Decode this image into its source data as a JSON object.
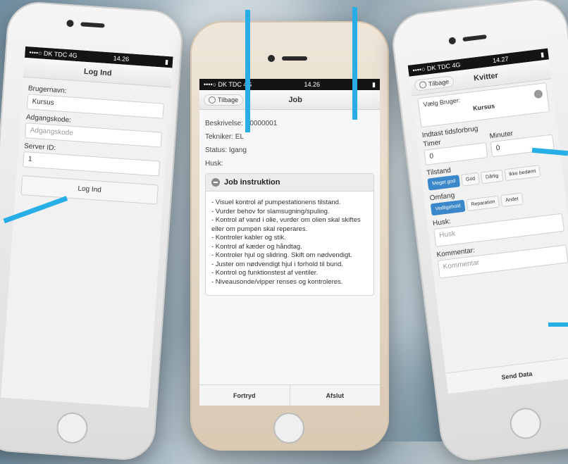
{
  "left_phone": {
    "statusbar": {
      "carrier": "••••○ DK TDC  4G",
      "time": "14.26"
    },
    "title": "Log Ind",
    "fields": [
      {
        "label": "Brugernavn:",
        "value": "Kursus"
      },
      {
        "label": "Adgangskode:",
        "placeholder": "Adgangskode"
      },
      {
        "label": "Server ID:",
        "value": "1"
      }
    ],
    "login_button": "Log Ind"
  },
  "middle_phone": {
    "statusbar": {
      "carrier": "••••○ DK TDC  4G",
      "time": "14.26"
    },
    "back_label": "Tilbage",
    "title": "Job",
    "info": [
      "Beskrivelse: P0000001",
      "Tekniker: EL",
      "Status: Igang",
      "Husk:"
    ],
    "card_title": "Job instruktion",
    "instructions": [
      "- Visuel kontrol af pumpestationens tilstand.",
      "- Vurder behov for slamsugning/spuling.",
      "- Kontrol af vand i olie, vurder om olien skal skiftes eller om pumpen skal reperares.",
      "- Kontroler kabler og stik.",
      "- Kontrol af kæder og håndtag.",
      "- Kontroler hjul og slidring. Skift om nødvendigt.",
      "- Juster om nødvendigt hjul i forhold til bund.",
      "- Kontrol og funktionstest af ventiler.",
      "- Niveausonde/vipper renses og kontroleres."
    ],
    "footer": {
      "cancel": "Fortryd",
      "finish": "Afslut"
    }
  },
  "right_phone": {
    "statusbar": {
      "carrier": "••••○ DK TDC  4G",
      "time": "14.27"
    },
    "back_label": "Tilbage",
    "title": "Kvitter",
    "select_label": "Vælg Bruger:",
    "select_value": "Kursus",
    "time_section": "Indtast tidsforbrug",
    "hours_label": "Timer",
    "hours_value": "0",
    "minutes_label": "Minuter",
    "minutes_value": "0",
    "state_label": "Tilstand",
    "state_options": [
      "Meget god",
      "God",
      "Dårlig",
      "Ikke bedømt"
    ],
    "scope_label": "Omfang",
    "scope_options": [
      "Vedligehold",
      "Reparation",
      "Andet"
    ],
    "remember_label": "Husk:",
    "remember_placeholder": "Husk",
    "comment_label": "Kommentar:",
    "comment_placeholder": "Kommentar",
    "send_button": "Send Data"
  },
  "colors": {
    "accent": "#27aee6",
    "active_segment": "#3a87c9"
  }
}
